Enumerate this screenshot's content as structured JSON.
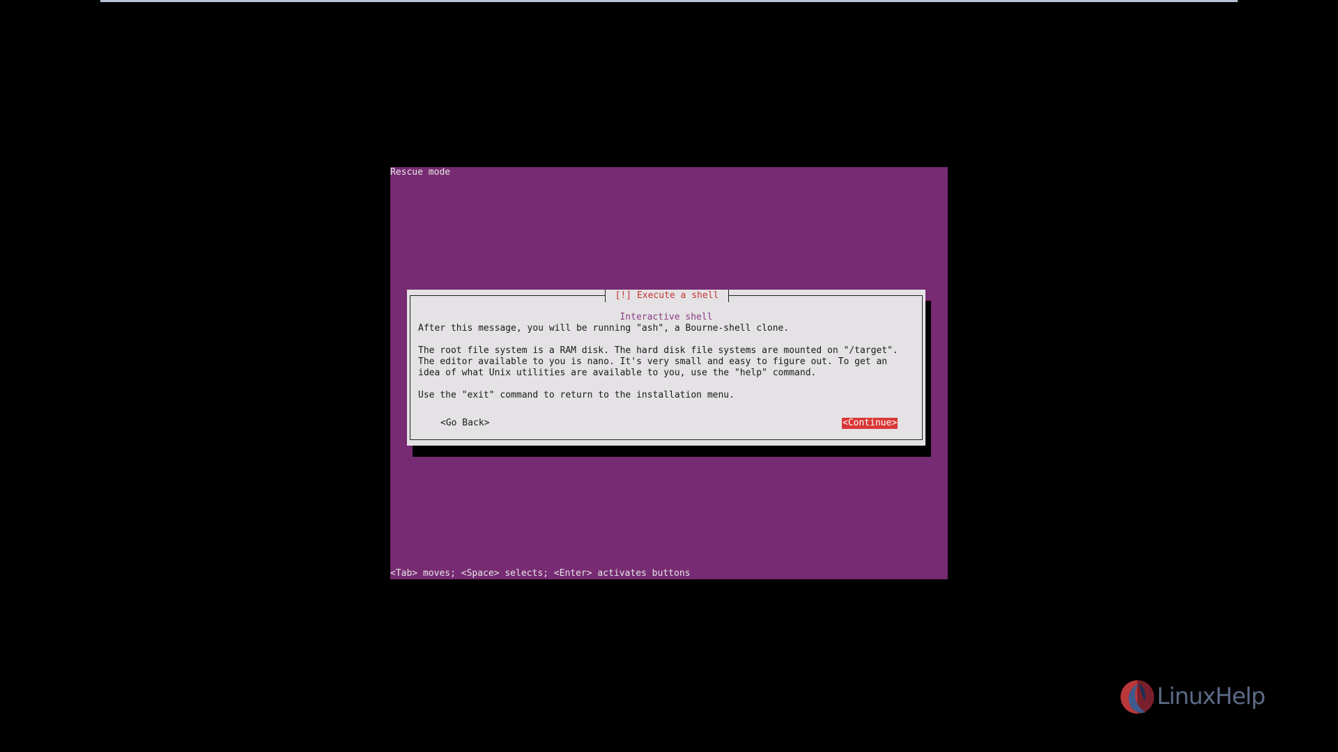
{
  "screen": {
    "title": "Rescue mode",
    "help_line": "<Tab> moves; <Space> selects; <Enter> activates buttons"
  },
  "dialog": {
    "title": "[!] Execute a shell",
    "subtitle": "Interactive shell",
    "lines": [
      "After this message, you will be running \"ash\", a Bourne-shell clone.",
      "The root file system is a RAM disk. The hard disk file systems are mounted on \"/target\".",
      "The editor available to you is nano. It's very small and easy to figure out. To get an",
      "idea of what Unix utilities are available to you, use the \"help\" command.",
      "Use the \"exit\" command to return to the installation menu."
    ],
    "go_back_label": "<Go Back>",
    "continue_label": "<Continue>"
  },
  "watermark": {
    "text": "LinuxHelp",
    "icon": "linuxhelp-logo-icon"
  },
  "colors": {
    "background": "#000000",
    "screen": "#772b72",
    "dialog": "#e4e2e4",
    "dialog_title": "#c63535",
    "subtitle": "#8d3a86",
    "selected_button": "#d93838"
  }
}
